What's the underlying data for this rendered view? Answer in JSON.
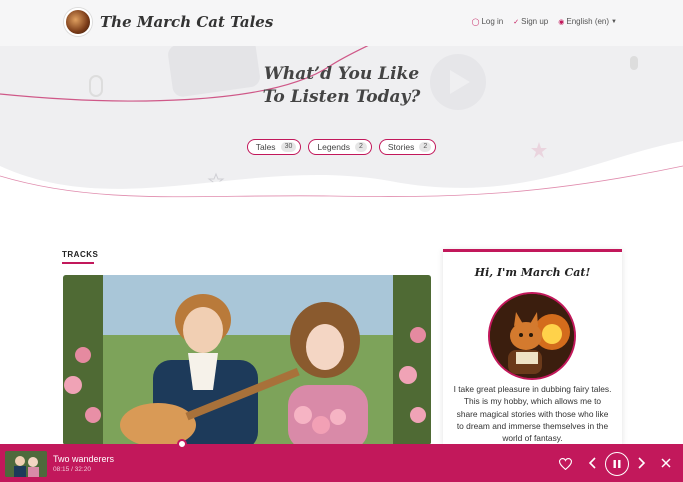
{
  "site": {
    "title": "The March Cat Tales"
  },
  "nav": {
    "login": "Log in",
    "signup": "Sign up",
    "language": "English (en)"
  },
  "hero": {
    "title_line1": "What’d You Like",
    "title_line2": "To Listen Today?"
  },
  "categories": [
    {
      "label": "Tales",
      "count": "30"
    },
    {
      "label": "Legends",
      "count": "2"
    },
    {
      "label": "Stories",
      "count": "2"
    }
  ],
  "tracks": {
    "heading": "TRACKS"
  },
  "card": {
    "title": "Hi, I'm March Cat!",
    "bio": "I take great pleasure in dubbing fairy tales. This is my hobby, which allows me to share magical stories with those who like to dream and immerse themselves in the world of fantasy."
  },
  "player": {
    "track_title": "Two wanderers",
    "time": "08:15 / 32:20",
    "progress": 0.26
  },
  "colors": {
    "accent": "#c2185b",
    "hero_bg": "#efeff1",
    "header_bg": "#f6f6f7"
  },
  "icons": [
    "user-icon",
    "signup-icon",
    "globe-icon",
    "caret-down-icon",
    "heart-icon",
    "prev-icon",
    "pause-icon",
    "next-icon",
    "close-icon"
  ]
}
